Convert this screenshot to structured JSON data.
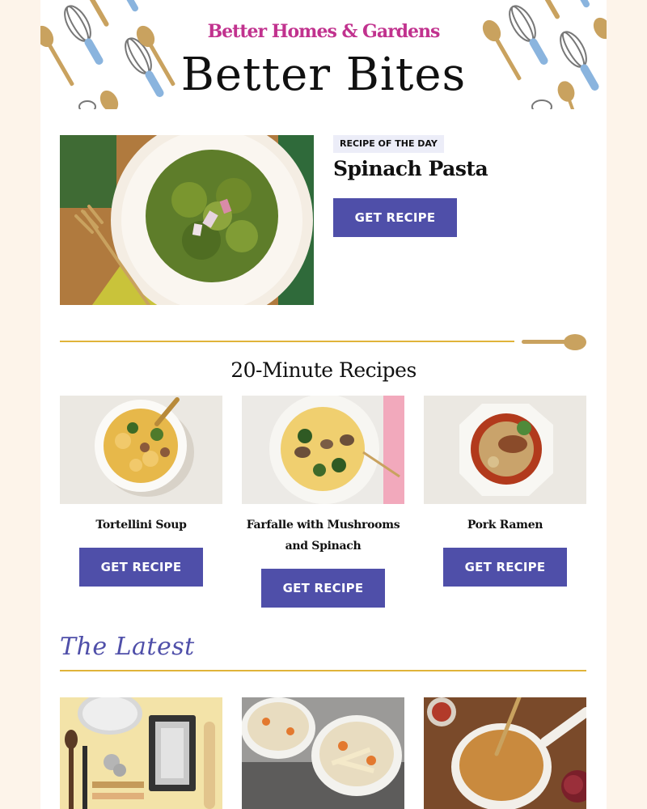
{
  "header": {
    "brand": "Better Homes & Gardens",
    "title": "Better Bites"
  },
  "recipe_of_day": {
    "badge": "RECIPE OF THE DAY",
    "title": "Spinach Pasta",
    "button": "GET RECIPE"
  },
  "quick_recipes": {
    "heading": "20-Minute Recipes",
    "items": [
      {
        "title": "Tortellini Soup",
        "button": "GET RECIPE"
      },
      {
        "title": "Farfalle with Mushrooms and Spinach",
        "button": "GET RECIPE"
      },
      {
        "title": "Pork Ramen",
        "button": "GET RECIPE"
      }
    ]
  },
  "latest": {
    "heading": "The Latest"
  },
  "colors": {
    "brand": "#c1328e",
    "button": "#4f4fa9",
    "accent_gold": "#e0b33a",
    "page_background": "#fdf4ea"
  }
}
